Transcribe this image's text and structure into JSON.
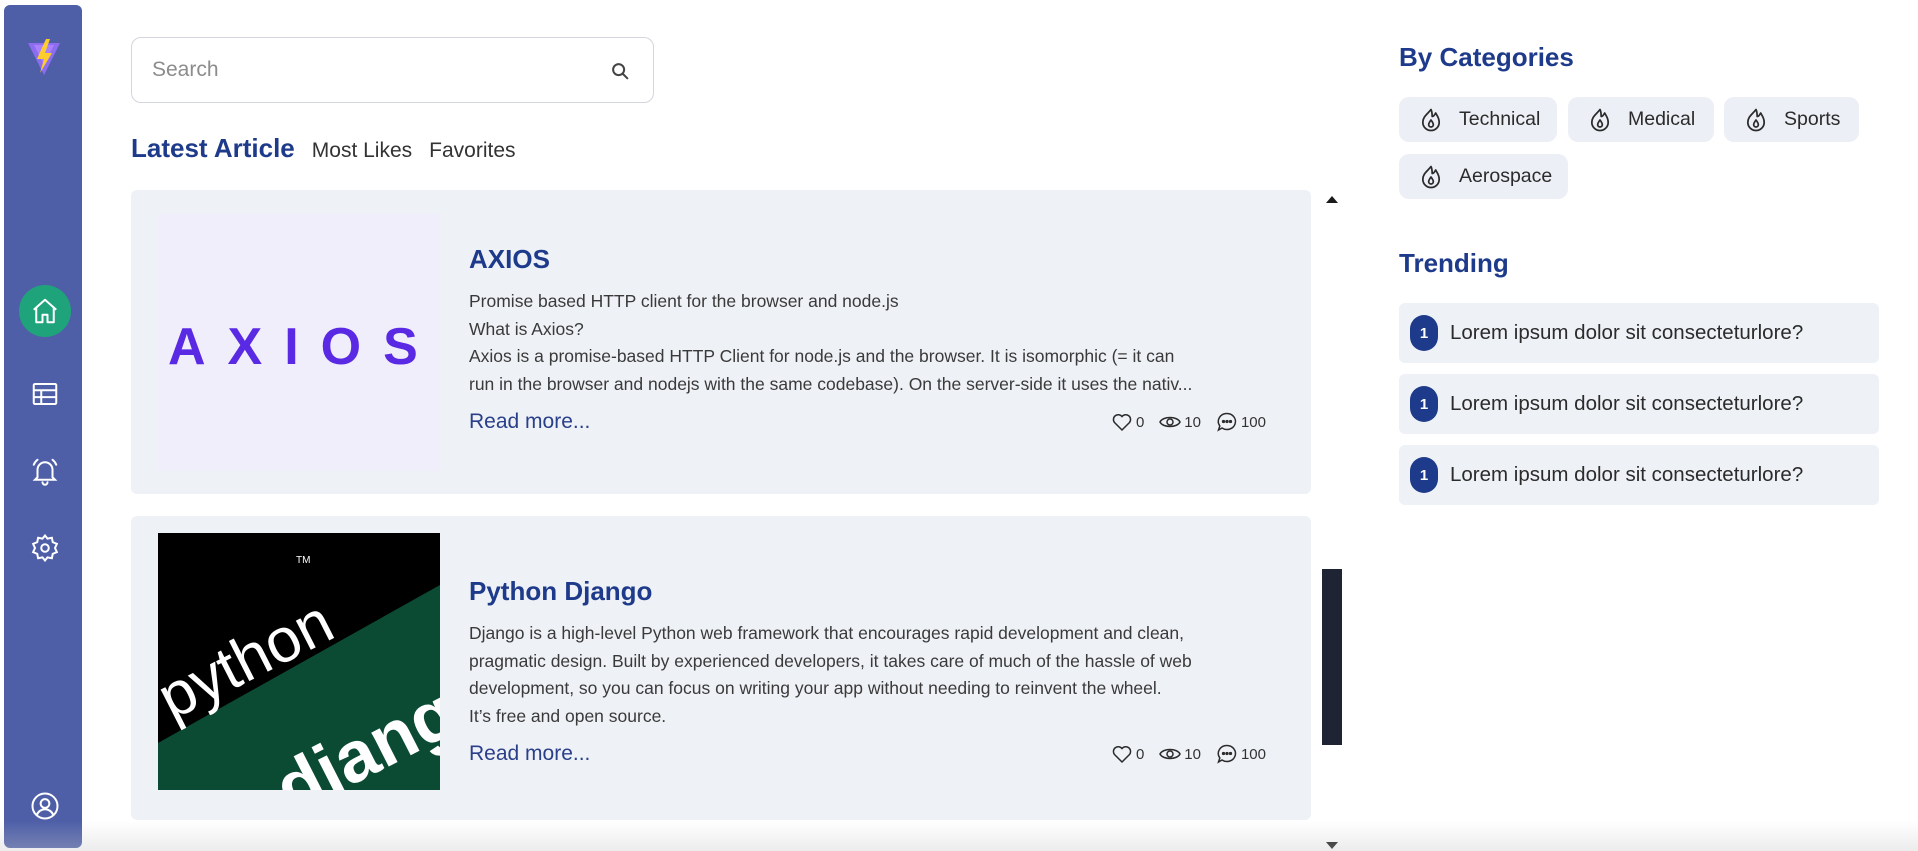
{
  "search": {
    "placeholder": "Search",
    "value": ""
  },
  "tabs": [
    {
      "label": "Latest Article",
      "active": true
    },
    {
      "label": "Most Likes",
      "active": false
    },
    {
      "label": "Favorites",
      "active": false
    }
  ],
  "sidebar": {
    "items": [
      {
        "name": "home",
        "icon": "home-icon",
        "active": true
      },
      {
        "name": "table",
        "icon": "table-icon",
        "active": false
      },
      {
        "name": "notifications",
        "icon": "bell-icon",
        "active": false
      },
      {
        "name": "settings",
        "icon": "gear-icon",
        "active": false
      },
      {
        "name": "profile",
        "icon": "user-circle-icon",
        "active": false
      }
    ],
    "accent_color": "#4e5fa8",
    "active_color": "#1fa37a"
  },
  "articles": [
    {
      "title": "AXIOS",
      "thumb_logo_text": "AXIOS",
      "description": [
        "Promise based HTTP client for the browser and node.js",
        "What is Axios?",
        "Axios is a promise-based HTTP Client for node.js and the browser. It is isomorphic (= it can",
        "run in the browser and nodejs with the same codebase). On the server-side it uses the nativ..."
      ],
      "read_more": "Read more...",
      "likes": "0",
      "views": "10",
      "comments": "100"
    },
    {
      "title": "Python Django",
      "thumb_logo_text": {
        "python": "python",
        "django": "djang",
        "tm": "TM"
      },
      "description": [
        "Django is a high-level Python web framework that encourages rapid development and clean,",
        "pragmatic design. Built by experienced developers, it takes care of much of the hassle of web",
        "development, so you can focus on writing your app without needing to reinvent the wheel.",
        "It’s free and open source."
      ],
      "read_more": "Read more...",
      "likes": "0",
      "views": "10",
      "comments": "100"
    }
  ],
  "categories": {
    "title": "By Categories",
    "items": [
      "Technical",
      "Medical",
      "Sports",
      "Aerospace"
    ]
  },
  "trending": {
    "title": "Trending",
    "items": [
      {
        "rank": "1",
        "text": "Lorem ipsum dolor sit consecteturlore?"
      },
      {
        "rank": "1",
        "text": "Lorem ipsum dolor sit consecteturlore?"
      },
      {
        "rank": "1",
        "text": "Lorem ipsum dolor sit consecteturlore?"
      }
    ]
  },
  "colors": {
    "title_blue": "#1e3a8a",
    "card_bg": "#eef1f6"
  }
}
